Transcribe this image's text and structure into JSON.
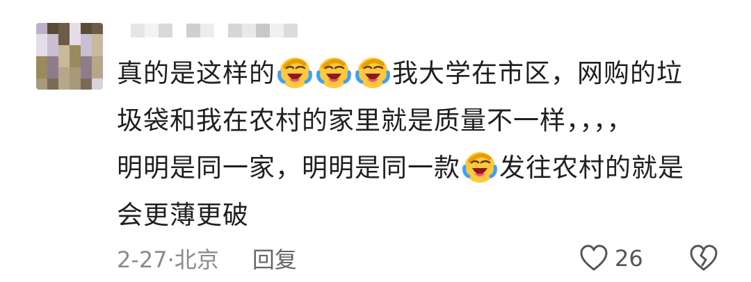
{
  "comment": {
    "lines": [
      [
        "真的是这样的",
        "emoji",
        "emoji",
        "emoji",
        "我大学在市区，网购的垃"
      ],
      [
        "圾袋和我在农村的家里就是质量不一样，，，，"
      ],
      [
        "明明是同一家，明明是同一款",
        "emoji",
        "发往农村的就是"
      ],
      [
        "会更薄更破"
      ]
    ],
    "emoji_icon": "face-with-tears-of-joy-icon"
  },
  "meta": {
    "date_location": "2-27·北京",
    "reply_label": "回复",
    "like_count": "26"
  },
  "colors": {
    "text": "#1f1f1f",
    "meta_text": "#8a8a8a",
    "icon_stroke": "#555555"
  }
}
